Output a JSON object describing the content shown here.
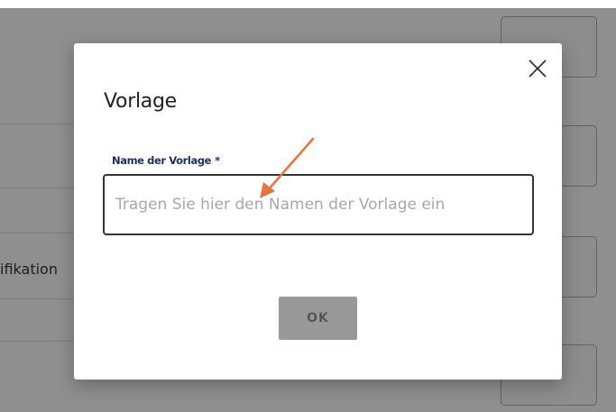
{
  "background": {
    "partial_label": "ifikation"
  },
  "dialog": {
    "title": "Vorlage",
    "close_icon": "close-icon"
  },
  "form": {
    "name_label": "Name der Vorlage",
    "required_marker": "*",
    "name_value": "",
    "name_placeholder": "Tragen Sie hier den Namen der Vorlage ein"
  },
  "actions": {
    "ok_label": "OK"
  },
  "colors": {
    "overlay": "#8f8f8f",
    "label": "#1e2f59",
    "button_bg": "#999999",
    "annotation_arrow": "#e8743a"
  }
}
